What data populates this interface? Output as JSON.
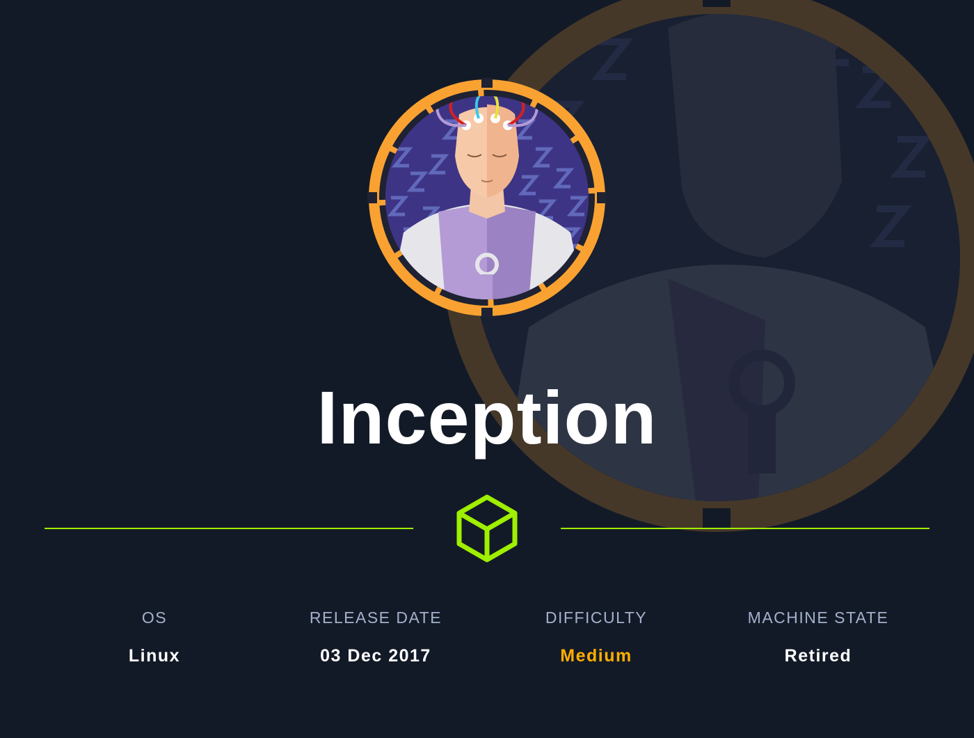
{
  "machine": {
    "name": "Inception",
    "avatar_icon": "dreaming-android-avatar"
  },
  "divider_icon": "hackthebox-cube-icon",
  "info": [
    {
      "label": "OS",
      "value": "Linux"
    },
    {
      "label": "RELEASE DATE",
      "value": "03 Dec 2017"
    },
    {
      "label": "DIFFICULTY",
      "value": "Medium"
    },
    {
      "label": "MACHINE STATE",
      "value": "Retired"
    }
  ],
  "colors": {
    "background": "#131a27",
    "accent_green": "#9fef00",
    "ring_orange": "#f9a232",
    "difficulty_medium": "#ffaf00",
    "label_gray": "#a4b1cd"
  }
}
